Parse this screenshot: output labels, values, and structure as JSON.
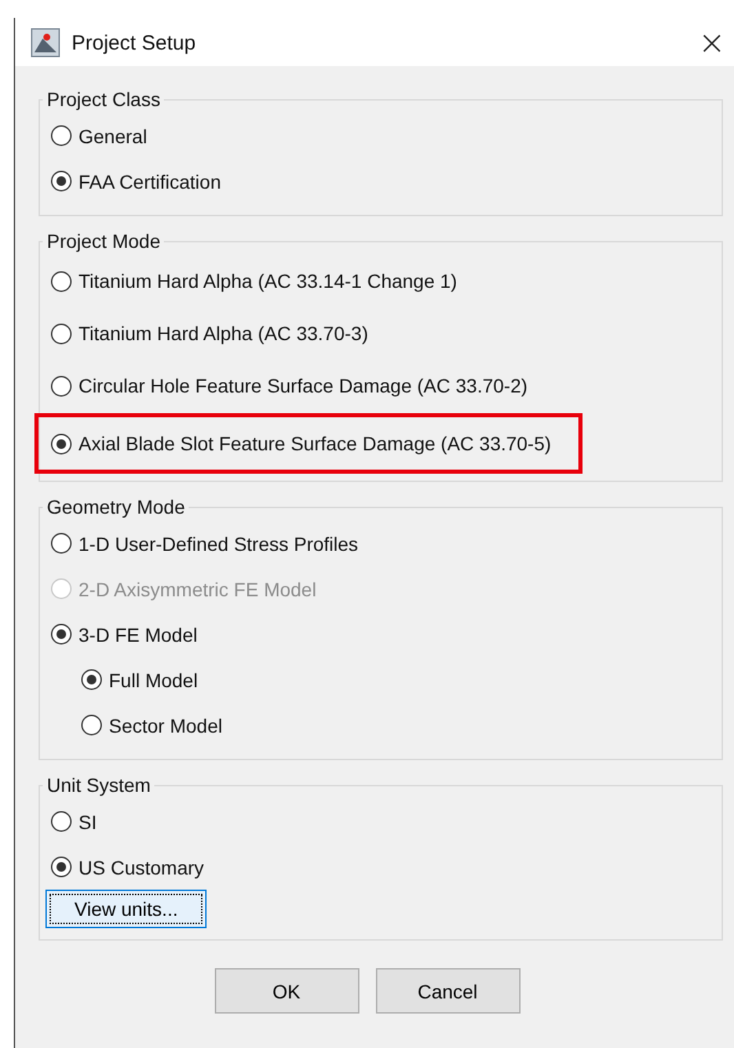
{
  "window": {
    "title": "Project Setup",
    "close": "×"
  },
  "groups": [
    {
      "title": "Project Class",
      "options": [
        {
          "label": "General",
          "selected": false,
          "disabled": false,
          "highlighted": false
        },
        {
          "label": "FAA Certification",
          "selected": true,
          "disabled": false,
          "highlighted": false
        }
      ]
    },
    {
      "title": "Project Mode",
      "options": [
        {
          "label": "Titanium Hard Alpha  (AC 33.14-1 Change 1)",
          "selected": false,
          "disabled": false,
          "highlighted": false
        },
        {
          "label": "Titanium Hard Alpha (AC 33.70-3)",
          "selected": false,
          "disabled": false,
          "highlighted": false
        },
        {
          "label": "Circular Hole Feature Surface Damage (AC 33.70-2)",
          "selected": false,
          "disabled": false,
          "highlighted": false
        },
        {
          "label": "Axial Blade Slot Feature Surface Damage (AC 33.70-5)",
          "selected": true,
          "disabled": false,
          "highlighted": true
        }
      ]
    },
    {
      "title": "Geometry Mode",
      "options": [
        {
          "label": "1-D User-Defined Stress Profiles",
          "selected": false,
          "disabled": false,
          "highlighted": false
        },
        {
          "label": "2-D Axisymmetric FE Model",
          "selected": false,
          "disabled": true,
          "highlighted": false
        },
        {
          "label": "3-D FE Model",
          "selected": true,
          "disabled": false,
          "highlighted": false,
          "children": [
            {
              "label": "Full Model",
              "selected": true,
              "disabled": false,
              "highlighted": false
            },
            {
              "label": "Sector Model",
              "selected": false,
              "disabled": false,
              "highlighted": false
            }
          ]
        }
      ]
    },
    {
      "title": "Unit System",
      "options": [
        {
          "label": "SI",
          "selected": false,
          "disabled": false,
          "highlighted": false
        },
        {
          "label": "US Customary",
          "selected": true,
          "disabled": false,
          "highlighted": false
        }
      ],
      "button": "View units..."
    }
  ],
  "buttons": [
    "OK",
    "Cancel"
  ]
}
